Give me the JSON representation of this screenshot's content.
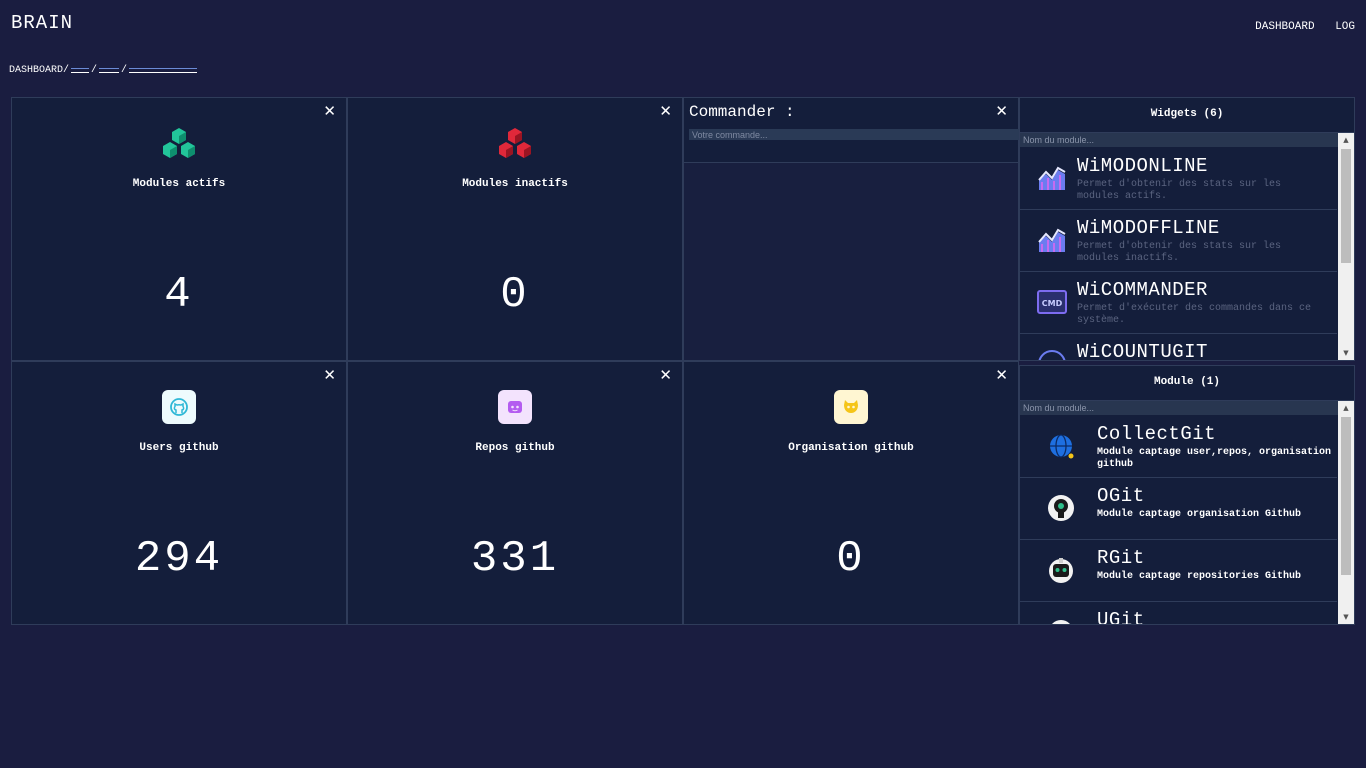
{
  "app": {
    "title": "BRAIN"
  },
  "nav": {
    "dashboard": "DASHBOARD",
    "log": "LOG"
  },
  "breadcrumb": {
    "root": "DASHBOARD/",
    "sep": "/"
  },
  "stats": [
    {
      "title": "Modules actifs",
      "value": "4",
      "icon": "modules-active-icon",
      "color": "#22c59a"
    },
    {
      "title": "Modules inactifs",
      "value": "0",
      "icon": "modules-inactive-icon",
      "color": "#e0283a"
    },
    {
      "title": "Users github",
      "value": "294",
      "icon": "github-icon",
      "color": "#3fc8e0"
    },
    {
      "title": "Repos github",
      "value": "331",
      "icon": "github-repo-icon",
      "color": "#b45cf0"
    },
    {
      "title": "Organisation github",
      "value": "0",
      "icon": "github-org-icon",
      "color": "#f5c518"
    }
  ],
  "commander": {
    "title": "Commander :",
    "placeholder": "Votre commande..."
  },
  "widgets": {
    "header": "Widgets (6)",
    "placeholder": "Nom du module...",
    "items": [
      {
        "name": "WiMODONLINE",
        "desc": "Permet d'obtenir des stats sur les modules actifs."
      },
      {
        "name": "WiMODOFFLINE",
        "desc": "Permet d'obtenir des stats sur les modules inactifs."
      },
      {
        "name": "WiCOMMANDER",
        "desc": "Permet d'exécuter des commandes dans ce système."
      },
      {
        "name": "WiCOUNTUGIT",
        "desc": ""
      }
    ]
  },
  "modules": {
    "header": "Module (1)",
    "placeholder": "Nom du module...",
    "items": [
      {
        "name": "CollectGit",
        "desc": "Module captage user,repos, organisation github"
      },
      {
        "name": "OGit",
        "desc": "Module captage organisation Github"
      },
      {
        "name": "RGit",
        "desc": "Module captage repositories Github"
      },
      {
        "name": "UGit",
        "desc": ""
      }
    ]
  },
  "close_glyph": "✕",
  "scroll": {
    "up": "▲",
    "down": "▼"
  }
}
